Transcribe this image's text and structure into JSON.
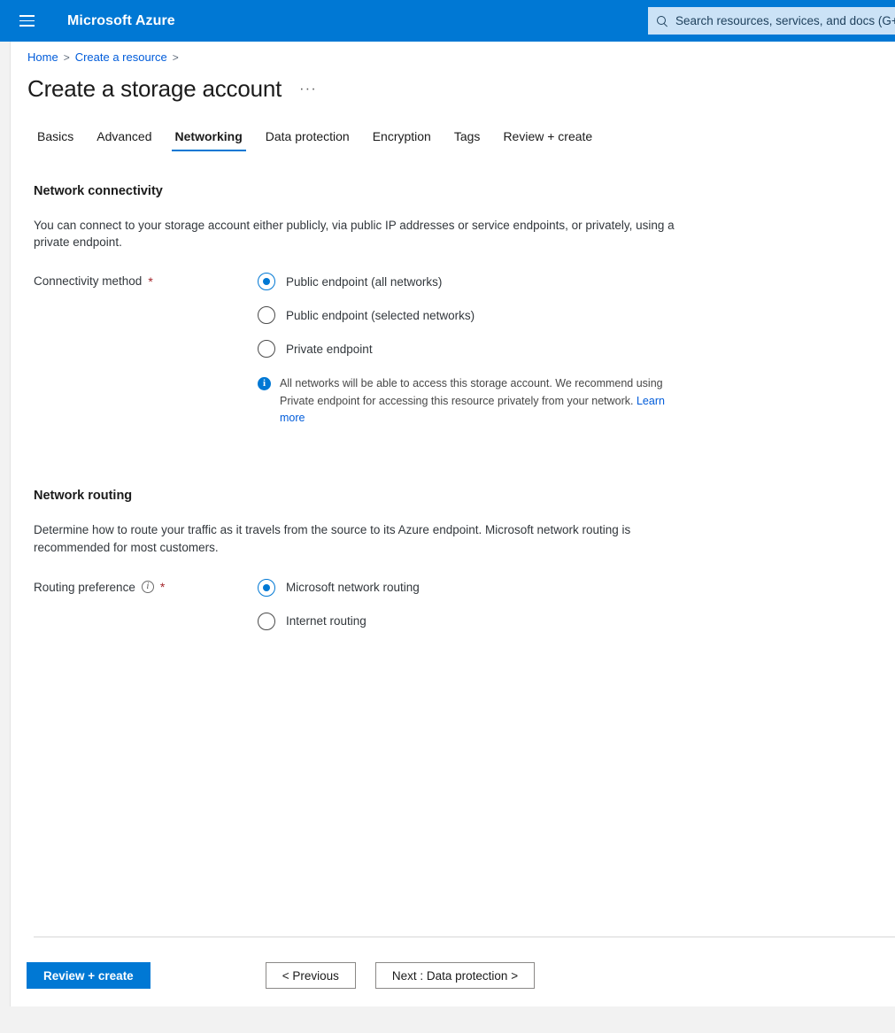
{
  "topbar": {
    "menu_icon": "hamburger-icon",
    "brand": "Microsoft Azure",
    "search": {
      "icon": "search-icon",
      "placeholder": "Search resources, services, and docs (G+/)"
    }
  },
  "breadcrumb": {
    "items": [
      {
        "label": "Home"
      },
      {
        "label": "Create a resource"
      }
    ],
    "separator": ">"
  },
  "page": {
    "title": "Create a storage account",
    "more_actions": "···"
  },
  "tabs": [
    {
      "label": "Basics",
      "active": false
    },
    {
      "label": "Advanced",
      "active": false
    },
    {
      "label": "Networking",
      "active": true
    },
    {
      "label": "Data protection",
      "active": false
    },
    {
      "label": "Encryption",
      "active": false
    },
    {
      "label": "Tags",
      "active": false
    },
    {
      "label": "Review + create",
      "active": false
    }
  ],
  "sections": {
    "connectivity": {
      "heading": "Network connectivity",
      "description": "You can connect to your storage account either publicly, via public IP addresses or service endpoints, or privately, using a private endpoint.",
      "field_label": "Connectivity method",
      "required_marker": "*",
      "options": [
        {
          "label": "Public endpoint (all networks)",
          "selected": true
        },
        {
          "label": "Public endpoint (selected networks)",
          "selected": false
        },
        {
          "label": "Private endpoint",
          "selected": false
        }
      ],
      "note": {
        "icon": "info-filled-icon",
        "text": "All networks will be able to access this storage account. We recommend using Private endpoint for accessing this resource privately from your network.",
        "link_label": "Learn more"
      }
    },
    "routing": {
      "heading": "Network routing",
      "description": "Determine how to route your traffic as it travels from the source to its Azure endpoint. Microsoft network routing is recommended for most customers.",
      "field_label": "Routing preference",
      "info_icon": "info-outline-icon",
      "required_marker": "*",
      "options": [
        {
          "label": "Microsoft network routing",
          "selected": true
        },
        {
          "label": "Internet routing",
          "selected": false
        }
      ]
    }
  },
  "footer": {
    "review_create": "Review + create",
    "previous": "< Previous",
    "next": "Next : Data protection >"
  },
  "colors": {
    "azure_blue": "#0078d4",
    "link_blue": "#015cda",
    "required_red": "#a4262c",
    "search_bg": "#cbe2f6"
  }
}
